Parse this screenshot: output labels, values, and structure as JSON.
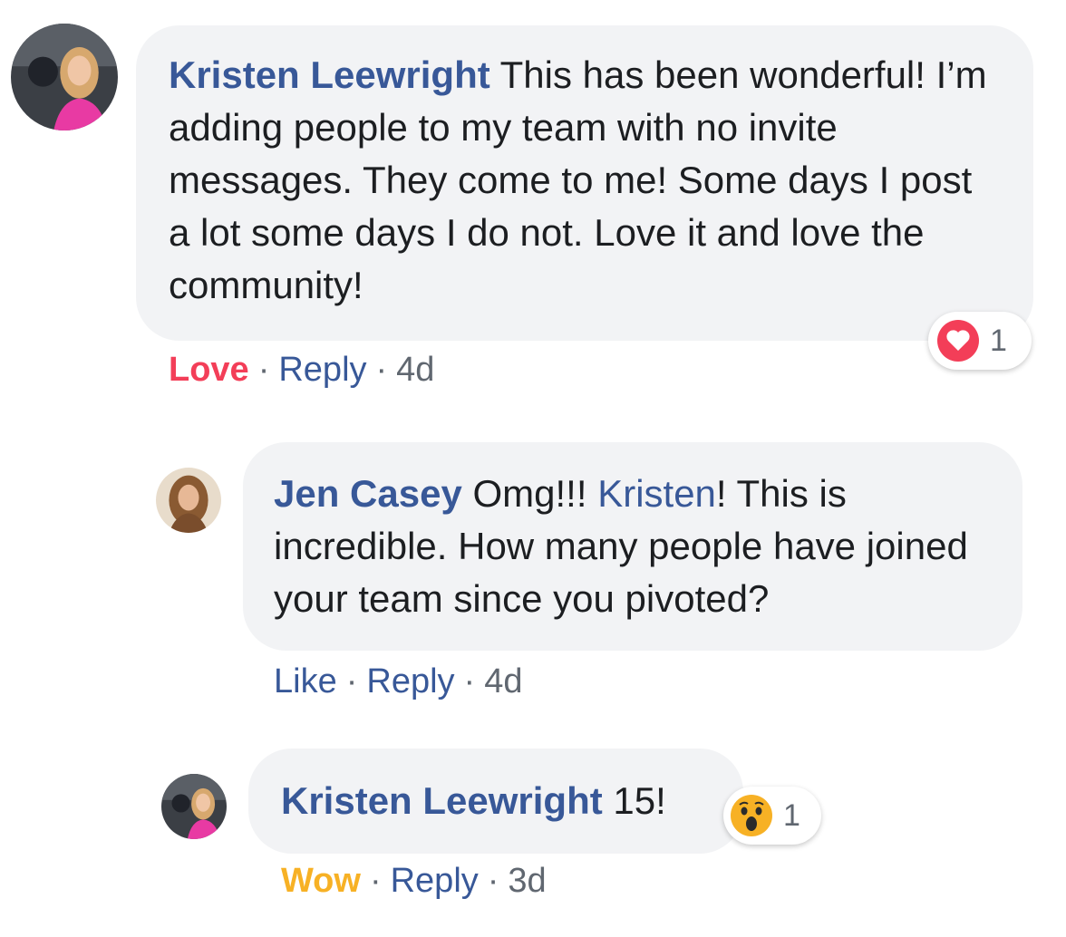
{
  "comments": [
    {
      "author": "Kristen Leewright",
      "text": "This has been wonderful! I’m adding people to my team with no invite messages. They come to me! Some days I post a lot some days I do not. Love it and love the community!",
      "reaction_action": "Love",
      "reply_label": "Reply",
      "time": "4d",
      "reaction_icon": "love-icon",
      "reaction_count": "1",
      "accent_color": "#f33e58"
    },
    {
      "author": "Jen Casey",
      "text_before_mention": "Omg!!!",
      "mention": "Kristen",
      "text_after_mention": "! This is incredible. How many people have joined your team since you pivoted?",
      "reaction_action": "Like",
      "reply_label": "Reply",
      "time": "4d"
    },
    {
      "author": "Kristen Leewright",
      "text": "15!",
      "reaction_action": "Wow",
      "reply_label": "Reply",
      "time": "3d",
      "reaction_icon": "wow-icon",
      "reaction_count": "1",
      "accent_color": "#f7b125"
    }
  ],
  "separator": "·",
  "colors": {
    "link": "#385898",
    "bubble": "#f2f3f5",
    "meta": "#606770"
  }
}
